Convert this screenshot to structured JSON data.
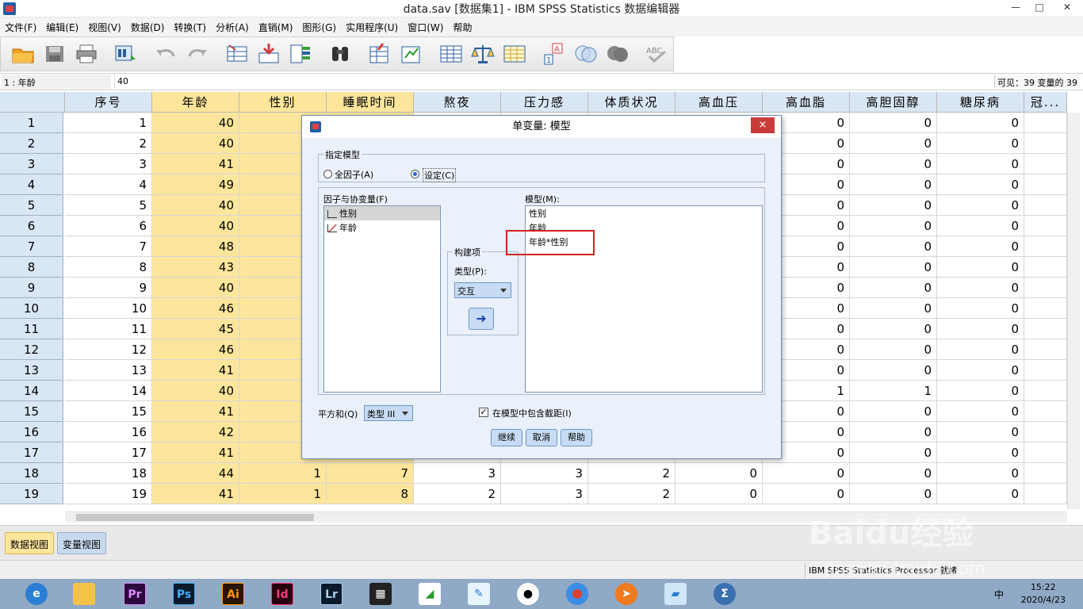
{
  "window": {
    "title": "data.sav [数据集1] - IBM SPSS Statistics 数据编辑器"
  },
  "menu": [
    "文件(F)",
    "编辑(E)",
    "视图(V)",
    "数据(D)",
    "转换(T)",
    "分析(A)",
    "直销(M)",
    "图形(G)",
    "实用程序(U)",
    "窗口(W)",
    "帮助"
  ],
  "toolbar_icons": [
    "open-folder-icon",
    "save-icon",
    "print-icon",
    "dialog-recall-icon",
    "undo-icon",
    "redo-icon",
    "goto-case-icon",
    "goto-variable-icon",
    "variables-icon",
    "find-icon",
    "insert-cases-icon",
    "insert-variable-icon",
    "split-file-icon",
    "weight-cases-icon",
    "select-cases-icon",
    "value-labels-icon",
    "use-sets-icon",
    "show-all-icon",
    "spell-check-icon"
  ],
  "cell_editor": {
    "ref": "1 : 年龄",
    "value": "40",
    "visible": "可见：39 变量的 39"
  },
  "columns": [
    "序号",
    "年龄",
    "性别",
    "睡眠时间",
    "熬夜",
    "压力感",
    "体质状况",
    "高血压",
    "高血脂",
    "高胆固醇",
    "糖尿病",
    "冠..."
  ],
  "rows": [
    {
      "n": "1",
      "c": [
        "1",
        "40",
        "",
        "",
        "",
        "",
        "",
        "",
        "0",
        "0",
        "0"
      ]
    },
    {
      "n": "2",
      "c": [
        "2",
        "40",
        "",
        "",
        "",
        "",
        "",
        "",
        "0",
        "0",
        "0"
      ]
    },
    {
      "n": "3",
      "c": [
        "3",
        "41",
        "",
        "",
        "",
        "",
        "",
        "",
        "0",
        "0",
        "0"
      ]
    },
    {
      "n": "4",
      "c": [
        "4",
        "49",
        "",
        "",
        "",
        "",
        "",
        "",
        "0",
        "0",
        "0"
      ]
    },
    {
      "n": "5",
      "c": [
        "5",
        "40",
        "",
        "",
        "",
        "",
        "",
        "",
        "0",
        "0",
        "0"
      ]
    },
    {
      "n": "6",
      "c": [
        "6",
        "40",
        "",
        "",
        "",
        "",
        "",
        "",
        "0",
        "0",
        "0"
      ]
    },
    {
      "n": "7",
      "c": [
        "7",
        "48",
        "",
        "",
        "",
        "",
        "",
        "",
        "0",
        "0",
        "0"
      ]
    },
    {
      "n": "8",
      "c": [
        "8",
        "43",
        "",
        "",
        "",
        "",
        "",
        "",
        "0",
        "0",
        "0"
      ]
    },
    {
      "n": "9",
      "c": [
        "9",
        "40",
        "",
        "",
        "",
        "",
        "",
        "",
        "0",
        "0",
        "0"
      ]
    },
    {
      "n": "10",
      "c": [
        "10",
        "46",
        "",
        "",
        "",
        "",
        "",
        "",
        "0",
        "0",
        "0"
      ]
    },
    {
      "n": "11",
      "c": [
        "11",
        "45",
        "",
        "",
        "",
        "",
        "",
        "",
        "0",
        "0",
        "0"
      ]
    },
    {
      "n": "12",
      "c": [
        "12",
        "46",
        "",
        "",
        "",
        "",
        "",
        "",
        "0",
        "0",
        "0"
      ]
    },
    {
      "n": "13",
      "c": [
        "13",
        "41",
        "",
        "",
        "",
        "",
        "",
        "",
        "0",
        "0",
        "0"
      ]
    },
    {
      "n": "14",
      "c": [
        "14",
        "40",
        "",
        "",
        "",
        "",
        "",
        "",
        "1",
        "1",
        "0"
      ]
    },
    {
      "n": "15",
      "c": [
        "15",
        "41",
        "",
        "",
        "",
        "",
        "",
        "",
        "0",
        "0",
        "0"
      ]
    },
    {
      "n": "16",
      "c": [
        "16",
        "42",
        "",
        "",
        "",
        "",
        "",
        "",
        "0",
        "0",
        "0"
      ]
    },
    {
      "n": "17",
      "c": [
        "17",
        "41",
        "",
        "",
        "",
        "",
        "",
        "",
        "0",
        "0",
        "0"
      ]
    },
    {
      "n": "18",
      "c": [
        "18",
        "44",
        "1",
        "7",
        "3",
        "3",
        "2",
        "0",
        "0",
        "0",
        "0"
      ]
    },
    {
      "n": "19",
      "c": [
        "19",
        "41",
        "1",
        "8",
        "2",
        "3",
        "2",
        "0",
        "0",
        "0",
        "0"
      ]
    }
  ],
  "tabs": {
    "data_view": "数据视图",
    "variable_view": "变量视图"
  },
  "status": {
    "processor": "IBM SPSS Statistics Processor 就绪"
  },
  "dialog": {
    "title": "单变量: 模型",
    "close": "×",
    "specify_model": "指定模型",
    "full_factorial": "全因子(A)",
    "custom": "设定(C)",
    "factors_label": "因子与协变量(F)",
    "factors": [
      "性别",
      "年龄"
    ],
    "model_label": "模型(M):",
    "model_terms": [
      "性别",
      "年龄",
      "年龄*性别"
    ],
    "build_term": "构建项",
    "type_label": "类型(P):",
    "type_value": "交互",
    "sum_of_squares_label": "平方和(Q)",
    "sum_of_squares_value": "类型 III",
    "include_intercept": "在模型中包含截距(I)",
    "continue": "继续",
    "cancel": "取消",
    "help": "帮助"
  },
  "taskbar": {
    "apps": [
      "Pr",
      "Ps",
      "Ai",
      "Id",
      "Lr"
    ],
    "time": "15:22",
    "date": "2020/4/23",
    "ime": "中"
  },
  "watermark": {
    "brand": "Baidu经验",
    "url": "jingyan.baidu.com"
  }
}
